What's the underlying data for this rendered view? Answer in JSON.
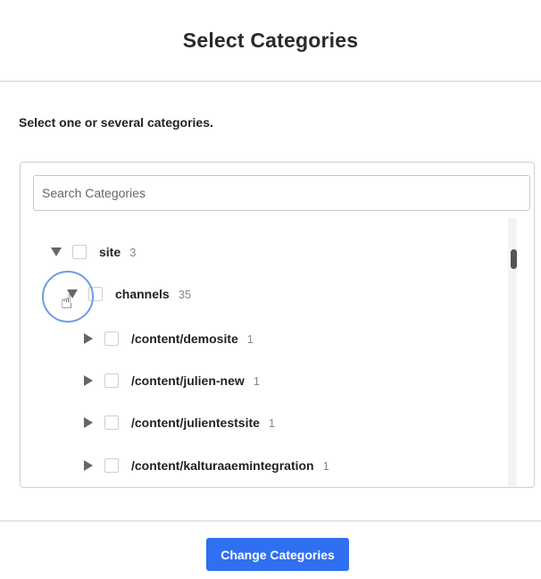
{
  "dialog": {
    "title": "Select Categories",
    "instructions": "Select one or several categories.",
    "search_placeholder": "Search Categories",
    "primary_button": "Change Categories"
  },
  "tree": {
    "root": {
      "label": "site",
      "count": "3",
      "expanded": true
    },
    "channels": {
      "label": "channels",
      "count": "35",
      "expanded": true
    },
    "children": [
      {
        "label": "/content/demosite",
        "count": "1"
      },
      {
        "label": "/content/julien-new",
        "count": "1"
      },
      {
        "label": "/content/julientestsite",
        "count": "1"
      },
      {
        "label": "/content/kalturaaemintegration",
        "count": "1"
      }
    ]
  },
  "icons": {
    "expanded": "caret-down-icon",
    "collapsed": "caret-right-icon",
    "cursor": "hand-pointer-icon"
  },
  "colors": {
    "accent": "#2f6ff0",
    "focus_ring": "#6f9be6",
    "caret": "#666666"
  }
}
